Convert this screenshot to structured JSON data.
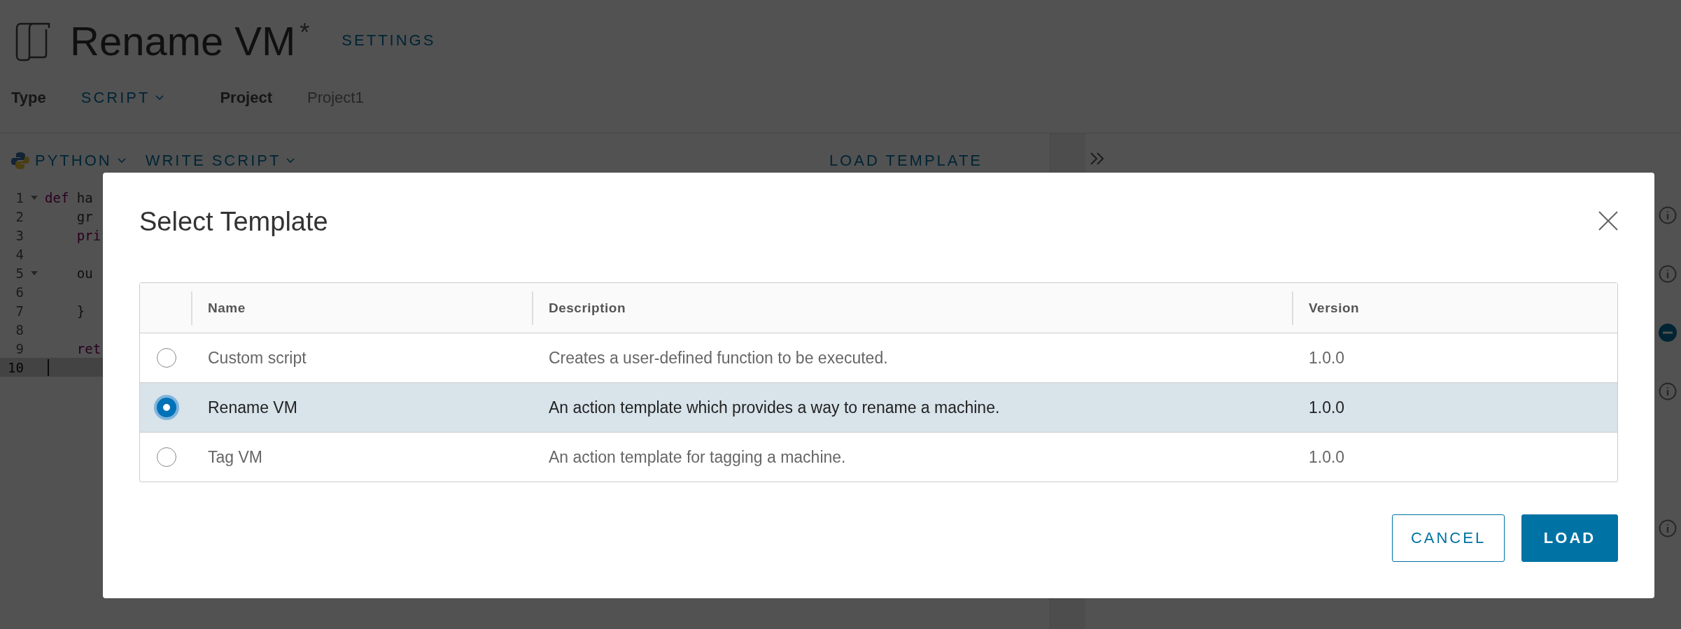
{
  "header": {
    "title": "Rename VM",
    "unsaved_mark": "*",
    "settings_link": "SETTINGS"
  },
  "meta": [
    {
      "label": "Type",
      "value": "SCRIPT",
      "kind": "dropdown"
    },
    {
      "label": "Project",
      "value": "Project1",
      "kind": "text"
    }
  ],
  "editor_toolbar": {
    "language": "PYTHON",
    "mode": "WRITE SCRIPT",
    "load_template": "LOAD TEMPLATE"
  },
  "code_lines": [
    {
      "number": "1",
      "foldable": true,
      "active": false,
      "segments": [
        {
          "text": "def",
          "kind": "keyword"
        },
        {
          "text": " ha",
          "kind": "plain"
        }
      ]
    },
    {
      "number": "2",
      "foldable": false,
      "active": false,
      "segments": [
        {
          "text": "    gr",
          "kind": "plain"
        }
      ]
    },
    {
      "number": "3",
      "foldable": false,
      "active": false,
      "segments": [
        {
          "text": "    pri",
          "kind": "keyword"
        }
      ]
    },
    {
      "number": "4",
      "foldable": false,
      "active": false
    },
    {
      "number": "5",
      "foldable": true,
      "active": false,
      "segments": [
        {
          "text": "    ou",
          "kind": "plain"
        }
      ]
    },
    {
      "number": "6",
      "foldable": false,
      "active": false
    },
    {
      "number": "7",
      "foldable": false,
      "active": false,
      "segments": [
        {
          "text": "    }",
          "kind": "plain"
        }
      ]
    },
    {
      "number": "8",
      "foldable": false,
      "active": false
    },
    {
      "number": "9",
      "foldable": false,
      "active": false,
      "segments": [
        {
          "text": "    ret",
          "kind": "keyword"
        }
      ]
    },
    {
      "number": "10",
      "foldable": false,
      "active": true
    }
  ],
  "modal": {
    "title": "Select Template",
    "columns": [
      "Name",
      "Description",
      "Version"
    ],
    "rows": [
      {
        "name": "Custom script",
        "description": "Creates a user-defined function to be executed.",
        "version": "1.0.0",
        "selected": false
      },
      {
        "name": "Rename VM",
        "description": "An action template which provides a way to rename a machine.",
        "version": "1.0.0",
        "selected": true
      },
      {
        "name": "Tag VM",
        "description": "An action template for tagging a machine.",
        "version": "1.0.0",
        "selected": false
      }
    ],
    "buttons": [
      {
        "label": "CANCEL",
        "kind": "secondary"
      },
      {
        "label": "LOAD",
        "kind": "primary"
      }
    ]
  }
}
